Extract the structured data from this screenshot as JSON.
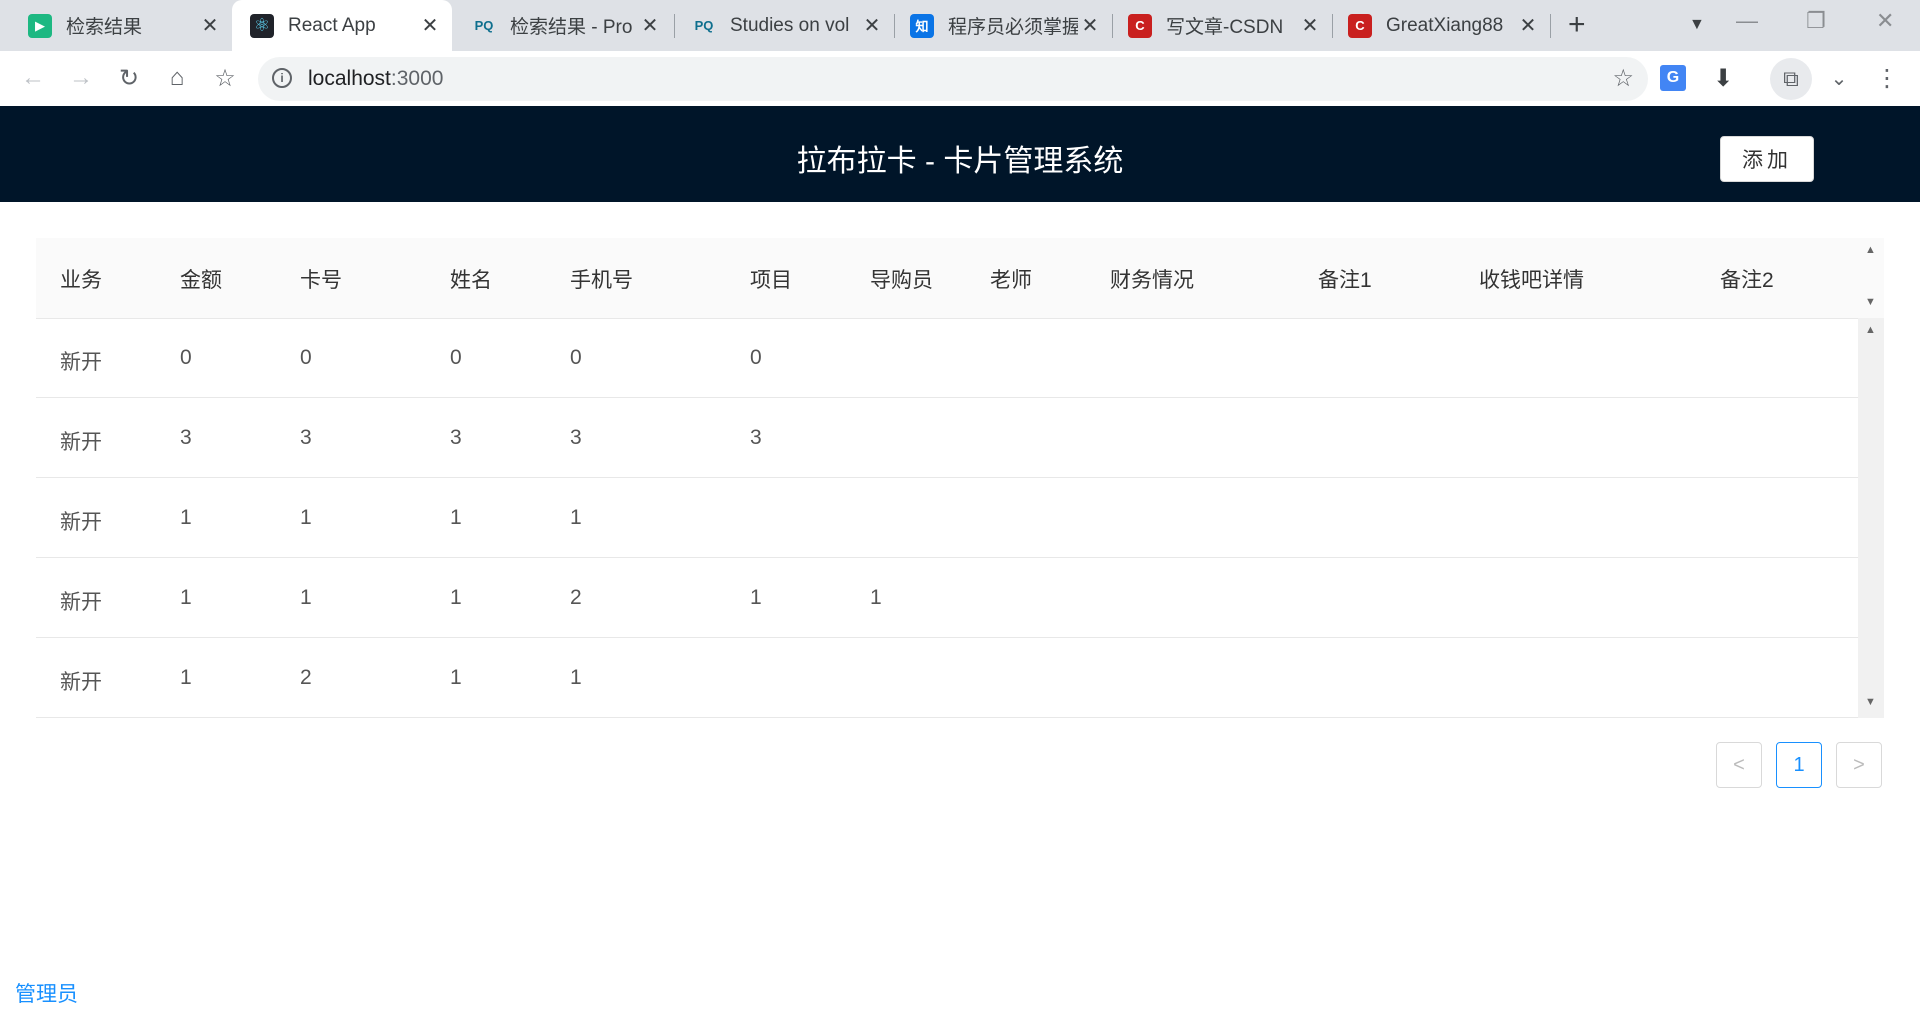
{
  "browser": {
    "tabs": [
      {
        "title": "检索结果",
        "icon": "play-favicon-icon",
        "icon_char": "▶",
        "icon_color": "#1db882"
      },
      {
        "title": "React App",
        "icon": "react-favicon-icon",
        "icon_char": "⚛",
        "icon_color": "#20232a"
      },
      {
        "title": "检索结果 - Pro",
        "icon": "pq-favicon-icon",
        "icon_char": "PQ",
        "icon_color": "#ffffff"
      },
      {
        "title": "Studies on vol",
        "icon": "pq-favicon-icon",
        "icon_char": "PQ",
        "icon_color": "#ffffff"
      },
      {
        "title": "程序员必须掌握",
        "icon": "zhihu-favicon-icon",
        "icon_char": "知",
        "icon_color": "#0a74e6"
      },
      {
        "title": "写文章-CSDN",
        "icon": "csdn-favicon-icon",
        "icon_char": "C",
        "icon_color": "#c9201f"
      },
      {
        "title": "GreatXiang88",
        "icon": "csdn-favicon-icon",
        "icon_char": "C",
        "icon_color": "#c9201f"
      }
    ],
    "url_host": "localhost",
    "url_port": ":3000"
  },
  "app": {
    "title": "拉布拉卡 - 卡片管理系统",
    "add_label": "添加",
    "header_color": "#001529",
    "accent_color": "#1890ff"
  },
  "table": {
    "columns": [
      "业务",
      "金额",
      "卡号",
      "姓名",
      "手机号",
      "项目",
      "导购员",
      "老师",
      "财务情况",
      "备注1",
      "收钱吧详情",
      "备注2"
    ],
    "rows": [
      [
        "新开",
        "0",
        "0",
        "0",
        "0",
        "0",
        "",
        "",
        "",
        "",
        "",
        ""
      ],
      [
        "新开",
        "3",
        "3",
        "3",
        "3",
        "3",
        "",
        "",
        "",
        "",
        "",
        ""
      ],
      [
        "新开",
        "1",
        "1",
        "1",
        "1",
        "",
        "",
        "",
        "",
        "",
        "",
        ""
      ],
      [
        "新开",
        "1",
        "1",
        "1",
        "2",
        "1",
        "1",
        "",
        "",
        "",
        "",
        ""
      ],
      [
        "新开",
        "1",
        "2",
        "1",
        "1",
        "",
        "",
        "",
        "",
        "",
        "",
        ""
      ]
    ]
  },
  "pagination": {
    "prev": "<",
    "current": "1",
    "next": ">"
  },
  "footer": {
    "admin_link": "管理员"
  }
}
